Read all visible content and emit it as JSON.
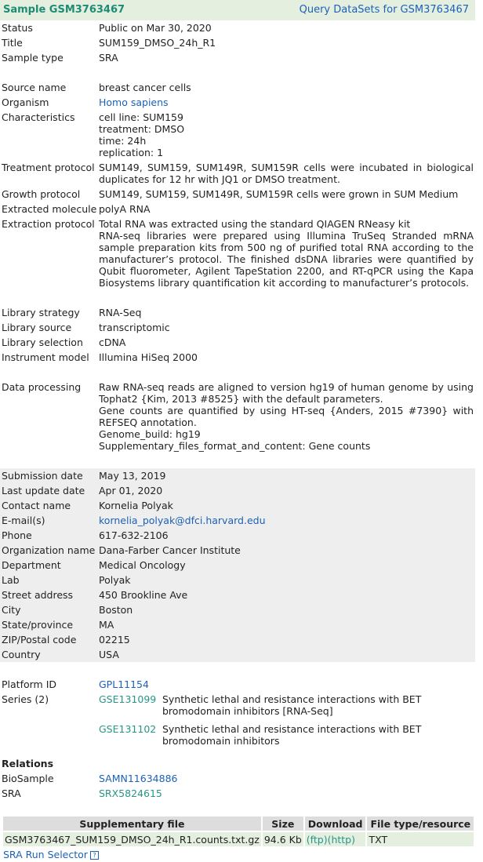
{
  "header": {
    "title": "Sample GSM3763467",
    "query_link": "Query DataSets for GSM3763467"
  },
  "status": {
    "label": "Status",
    "value": "Public on Mar 30, 2020"
  },
  "title_row": {
    "label": "Title",
    "value": "SUM159_DMSO_24h_R1"
  },
  "sample_type": {
    "label": "Sample type",
    "value": "SRA"
  },
  "source_name": {
    "label": "Source name",
    "value": "breast cancer cells"
  },
  "organism": {
    "label": "Organism",
    "value": "Homo sapiens"
  },
  "characteristics": {
    "label": "Characteristics",
    "lines": [
      "cell line: SUM159",
      "treatment: DMSO",
      "time: 24h",
      "replication: 1"
    ]
  },
  "treatment_protocol": {
    "label": "Treatment protocol",
    "value": "SUM149, SUM159, SUM149R, SUM159R cells were incubated in biological duplicates for 12 hr with JQ1 or DMSO treatment."
  },
  "growth_protocol": {
    "label": "Growth protocol",
    "value": "SUM149, SUM159, SUM149R, SUM159R cells were grown in SUM Medium"
  },
  "extracted_molecule": {
    "label": "Extracted molecule",
    "value": "polyA RNA"
  },
  "extraction_protocol": {
    "label": "Extraction protocol",
    "line1": "Total RNA was extracted using the standard QIAGEN RNeasy kit",
    "line2": "RNA-seq libraries were prepared using Illumina TruSeq Stranded mRNA sample preparation kits from 500 ng of purified total RNA according to the manufacturer’s protocol. The finished dsDNA libraries were quantified by Qubit fluorometer, Agilent TapeStation 2200, and RT-qPCR using the Kapa Biosystems library quantification kit according to manufacturer’s protocols."
  },
  "library_strategy": {
    "label": "Library strategy",
    "value": "RNA-Seq"
  },
  "library_source": {
    "label": "Library source",
    "value": "transcriptomic"
  },
  "library_selection": {
    "label": "Library selection",
    "value": "cDNA"
  },
  "instrument_model": {
    "label": "Instrument model",
    "value": "Illumina HiSeq 2000"
  },
  "data_processing": {
    "label": "Data processing",
    "p1": "Raw RNA-seq reads are aligned to version hg19 of human genome by using Tophat2 {Kim, 2013 #8525} with the default parameters.",
    "p2": "Gene counts are quantified by using HT-seq {Anders, 2015 #7390} with REFSEQ annotation.",
    "p3": "Genome_build: hg19",
    "p4": "Supplementary_files_format_and_content: Gene counts"
  },
  "contact": {
    "submission_date": {
      "label": "Submission date",
      "value": "May 13, 2019"
    },
    "last_update": {
      "label": "Last update date",
      "value": "Apr 01, 2020"
    },
    "contact_name": {
      "label": "Contact name",
      "value": "Kornelia Polyak"
    },
    "email": {
      "label": "E-mail(s)",
      "value": "kornelia_polyak@dfci.harvard.edu"
    },
    "phone": {
      "label": "Phone",
      "value": "617-632-2106"
    },
    "organization": {
      "label": "Organization name",
      "value": "Dana-Farber Cancer Institute"
    },
    "department": {
      "label": "Department",
      "value": "Medical Oncology"
    },
    "lab": {
      "label": "Lab",
      "value": "Polyak"
    },
    "street": {
      "label": "Street address",
      "value": "450 Brookline Ave"
    },
    "city": {
      "label": "City",
      "value": "Boston"
    },
    "state": {
      "label": "State/province",
      "value": "MA"
    },
    "zip": {
      "label": "ZIP/Postal code",
      "value": "02215"
    },
    "country": {
      "label": "Country",
      "value": "USA"
    }
  },
  "platform": {
    "label": "Platform ID",
    "value": "GPL11154"
  },
  "series": {
    "label": "Series (2)",
    "items": [
      {
        "id": "GSE131099",
        "desc": "Synthetic lethal and resistance interactions with BET bromodomain inhibitors [RNA-Seq]"
      },
      {
        "id": "GSE131102",
        "desc": "Synthetic lethal and resistance interactions with BET bromodomain inhibitors"
      }
    ]
  },
  "relations": {
    "title": "Relations",
    "biosample": {
      "label": "BioSample",
      "value": "SAMN11634886"
    },
    "sra": {
      "label": "SRA",
      "value": "SRX5824615"
    }
  },
  "supp_table": {
    "headers": [
      "Supplementary file",
      "Size",
      "Download",
      "File type/resource"
    ],
    "row": {
      "file": "GSM3763467_SUM159_DMSO_24h_R1.counts.txt.gz",
      "size": "94.6 Kb",
      "ftp": "(ftp)",
      "http": "(http)",
      "type": "TXT"
    }
  },
  "sra_run_selector": {
    "label": "SRA Run Selector",
    "help_icon": "?"
  }
}
